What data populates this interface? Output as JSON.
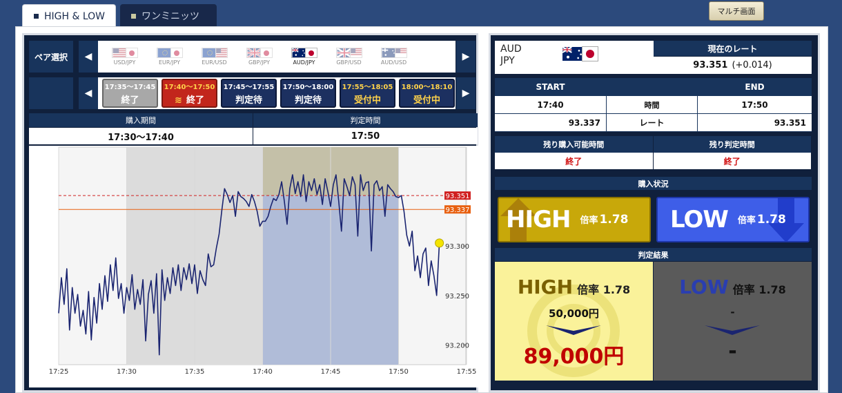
{
  "tabs": [
    {
      "label": "HIGH & LOW",
      "active": true
    },
    {
      "label": "ワンミニッツ",
      "active": false
    }
  ],
  "multi_screen_label": "マルチ画面",
  "pair_select": {
    "label": "ペア選択",
    "pairs": [
      {
        "label": "USD/JPY",
        "selected": false
      },
      {
        "label": "EUR/JPY",
        "selected": false
      },
      {
        "label": "EUR/USD",
        "selected": false
      },
      {
        "label": "GBP/JPY",
        "selected": false
      },
      {
        "label": "AUD/JPY",
        "selected": true
      },
      {
        "label": "GBP/USD",
        "selected": false
      },
      {
        "label": "AUD/USD",
        "selected": false
      }
    ]
  },
  "time_slots": [
    {
      "time": "17:35〜17:45",
      "status": "終了",
      "state": "closed"
    },
    {
      "time": "17:40〜17:50",
      "status": "終了",
      "state": "active"
    },
    {
      "time": "17:45〜17:55",
      "status": "判定待",
      "state": "judge"
    },
    {
      "time": "17:50〜18:00",
      "status": "判定待",
      "state": "judge"
    },
    {
      "time": "17:55〜18:05",
      "status": "受付中",
      "state": "recv"
    },
    {
      "time": "18:00〜18:10",
      "status": "受付中",
      "state": "recv"
    }
  ],
  "period": {
    "purchase_label": "購入期間",
    "purchase_value": "17:30〜17:40",
    "judge_label": "判定時間",
    "judge_value": "17:50"
  },
  "chart_data": {
    "type": "line",
    "x_tick_labels": [
      "17:25",
      "17:30",
      "17:35",
      "17:40",
      "17:45",
      "17:50",
      "17:55"
    ],
    "y_tick_labels": [
      "93.200",
      "93.250",
      "93.300"
    ],
    "ylim": [
      93.18,
      93.4
    ],
    "current_rate_label": "93.351",
    "strike_rate_label": "93.337",
    "current_rate": 93.351,
    "strike_rate": 93.337,
    "purchase_window": [
      "17:30",
      "17:40"
    ],
    "judge_window": [
      "17:40",
      "17:50"
    ],
    "colors": {
      "line": "#1a2470",
      "current": "#d02020",
      "strike": "#e86010",
      "purchase_bg": "#dcdcdc",
      "judge_top": "#c4c0a8",
      "judge_bottom": "#b0bcd8"
    },
    "series_minutes": [
      0.0,
      0.2,
      0.4,
      0.6,
      0.8,
      1.0,
      1.2,
      1.4,
      1.6,
      1.8,
      2.0,
      2.2,
      2.4,
      2.6,
      2.8,
      3.0,
      3.2,
      3.4,
      3.6,
      3.8,
      4.0,
      4.2,
      4.4,
      4.6,
      4.8,
      5.0,
      5.2,
      5.4,
      5.6,
      5.8,
      6.0,
      6.2,
      6.4,
      6.6,
      6.8,
      7.0,
      7.2,
      7.4,
      7.6,
      7.8,
      8.0,
      8.2,
      8.4,
      8.6,
      8.8,
      9.0,
      9.2,
      9.4,
      9.6,
      9.8,
      10.0,
      10.2,
      10.4,
      10.6,
      10.8,
      11.0,
      11.2,
      11.4,
      11.6,
      11.8,
      12.0,
      12.2,
      12.4,
      12.6,
      12.8,
      13.0,
      13.2,
      13.4,
      13.6,
      13.8,
      14.0,
      14.2,
      14.4,
      14.6,
      14.8,
      15.0,
      15.2,
      15.4,
      15.6,
      15.8,
      16.0,
      16.2,
      16.4,
      16.6,
      16.8,
      17.0,
      17.2,
      17.4,
      17.6,
      17.8,
      18.0,
      18.2,
      18.4,
      18.6,
      18.8,
      19.0,
      19.2,
      19.4,
      19.6,
      19.8,
      20.0,
      20.2,
      20.4,
      20.6,
      20.8,
      21.0,
      21.2,
      21.4,
      21.6,
      21.8,
      22.0,
      22.2,
      22.4,
      22.6,
      22.8,
      23.0,
      23.2,
      23.4,
      23.6,
      23.8,
      24.0,
      24.2,
      24.4,
      24.6,
      24.8,
      25.0,
      25.2,
      25.4,
      25.6,
      25.8,
      26.0,
      26.2,
      26.4,
      26.6,
      26.8,
      27.0,
      27.2,
      27.4,
      27.6,
      27.8,
      28.0
    ],
    "series_values": [
      93.232,
      93.268,
      93.241,
      93.277,
      93.215,
      93.258,
      93.232,
      93.251,
      93.219,
      93.235,
      93.211,
      93.254,
      93.205,
      93.248,
      93.222,
      93.262,
      93.236,
      93.27,
      93.244,
      93.281,
      93.255,
      93.288,
      93.247,
      93.262,
      93.232,
      93.258,
      93.245,
      93.271,
      93.236,
      93.256,
      93.241,
      93.266,
      93.204,
      93.251,
      93.265,
      93.232,
      93.272,
      93.19,
      93.276,
      93.245,
      93.268,
      93.252,
      93.278,
      93.26,
      93.281,
      93.255,
      93.278,
      93.266,
      93.282,
      93.262,
      93.281,
      93.252,
      93.275,
      93.266,
      93.26,
      93.292,
      93.279,
      93.281,
      93.298,
      93.312,
      93.336,
      93.358,
      93.352,
      93.344,
      93.351,
      93.33,
      93.355,
      93.35,
      93.348,
      93.345,
      93.34,
      93.352,
      93.345,
      93.335,
      93.32,
      93.325,
      93.325,
      93.33,
      93.34,
      93.348,
      93.346,
      93.352,
      93.365,
      93.345,
      93.322,
      93.358,
      93.372,
      93.353,
      93.365,
      93.35,
      93.372,
      93.345,
      93.365,
      93.356,
      93.368,
      93.352,
      93.362,
      93.342,
      93.368,
      93.355,
      93.34,
      93.362,
      93.372,
      93.345,
      93.315,
      93.368,
      93.36,
      93.351,
      93.37,
      93.362,
      93.31,
      93.372,
      93.356,
      93.364,
      93.365,
      93.295,
      93.362,
      93.366,
      93.356,
      93.36,
      93.33,
      93.362,
      93.358,
      93.355,
      93.35,
      93.349,
      93.351,
      93.335,
      93.311,
      93.3,
      93.315,
      93.275,
      93.29,
      93.268,
      93.292,
      93.298,
      93.26,
      93.285,
      93.27,
      93.25,
      93.303
    ]
  },
  "right": {
    "pair_code_line1": "AUD",
    "pair_code_line2": "JPY",
    "current_rate_label": "現在のレート",
    "current_rate": "93.351",
    "current_change": "(+0.014)",
    "start_label": "START",
    "end_label": "END",
    "time_label": "時間",
    "rate_label": "レート",
    "start_time": "17:40",
    "end_time": "17:50",
    "start_rate": "93.337",
    "end_rate": "93.351",
    "remain_buy_label": "残り購入可能時間",
    "remain_judge_label": "残り判定時間",
    "remain_buy_value": "終了",
    "remain_judge_value": "終了",
    "purchase_status_label": "購入状況",
    "high_label": "HIGH",
    "low_label": "LOW",
    "payout_prefix": "倍率",
    "payout_rate": "1.78",
    "result_label": "判定結果",
    "result_high_invest": "50,000円",
    "result_high_payout": "89,000円",
    "result_low_invest": "-",
    "result_low_payout": "-"
  }
}
